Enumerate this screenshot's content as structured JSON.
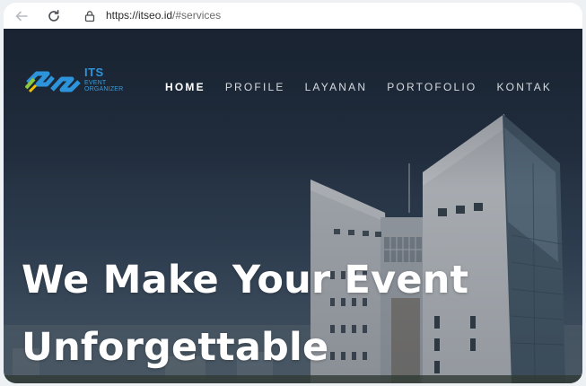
{
  "browser": {
    "url_prefix": "https://itseo.id",
    "url_rest": "/#services",
    "icons": [
      "back-arrow-icon",
      "reload-icon",
      "site-info-icon"
    ]
  },
  "brand": {
    "title": "ITS",
    "subtitle_1": "EVENT",
    "subtitle_2": "ORGANIZER",
    "colors": {
      "blue": "#2d94dc",
      "green": "#8dc63f"
    }
  },
  "nav": {
    "items": [
      {
        "label": "HOME",
        "active": true
      },
      {
        "label": "PROFILE",
        "active": false
      },
      {
        "label": "LAYANAN",
        "active": false
      },
      {
        "label": "PORTOFOLIO",
        "active": false
      },
      {
        "label": "KONTAK",
        "active": false
      }
    ]
  },
  "hero": {
    "line_1": "We Make Your Event",
    "line_2": "Unforgettable"
  }
}
